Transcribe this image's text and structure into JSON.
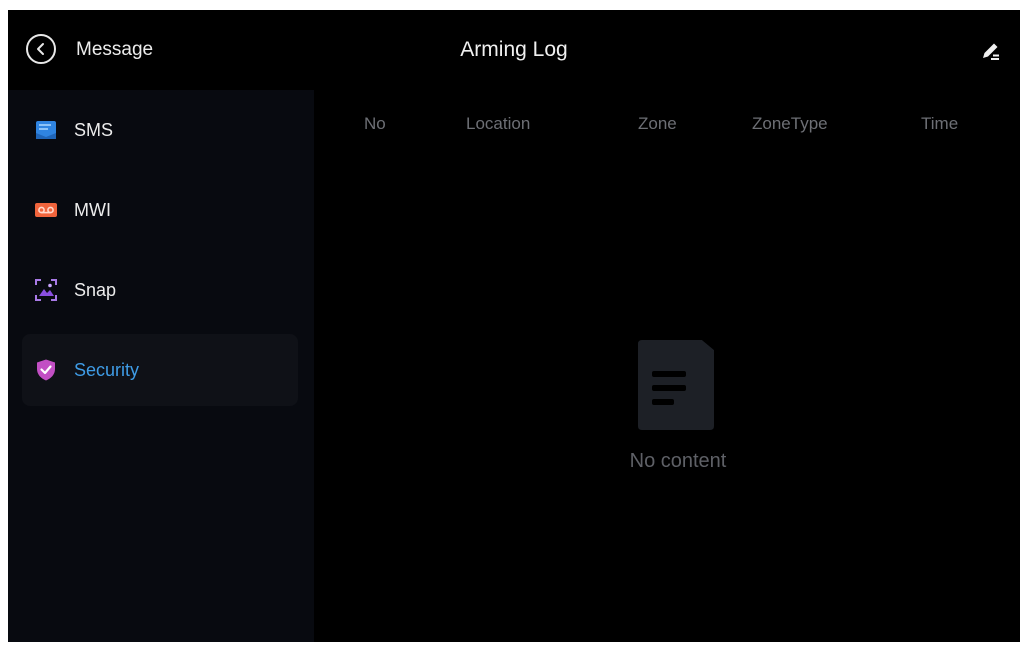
{
  "header": {
    "back_label": "Message",
    "title": "Arming Log"
  },
  "sidebar": {
    "items": [
      {
        "label": "SMS",
        "icon": "sms-icon",
        "color": "#2f84e0"
      },
      {
        "label": "MWI",
        "icon": "voicemail-icon",
        "color": "#f0643c"
      },
      {
        "label": "Snap",
        "icon": "snapshot-icon",
        "color": "#8a4fe0"
      },
      {
        "label": "Security",
        "icon": "shield-check-icon",
        "color": "#c24fc4",
        "active": true
      }
    ],
    "active_color": "#3f9ce6"
  },
  "table": {
    "columns": [
      "No",
      "Location",
      "Zone",
      "ZoneType",
      "Time"
    ],
    "rows": []
  },
  "empty_state": {
    "icon": "document-icon",
    "text": "No content"
  }
}
